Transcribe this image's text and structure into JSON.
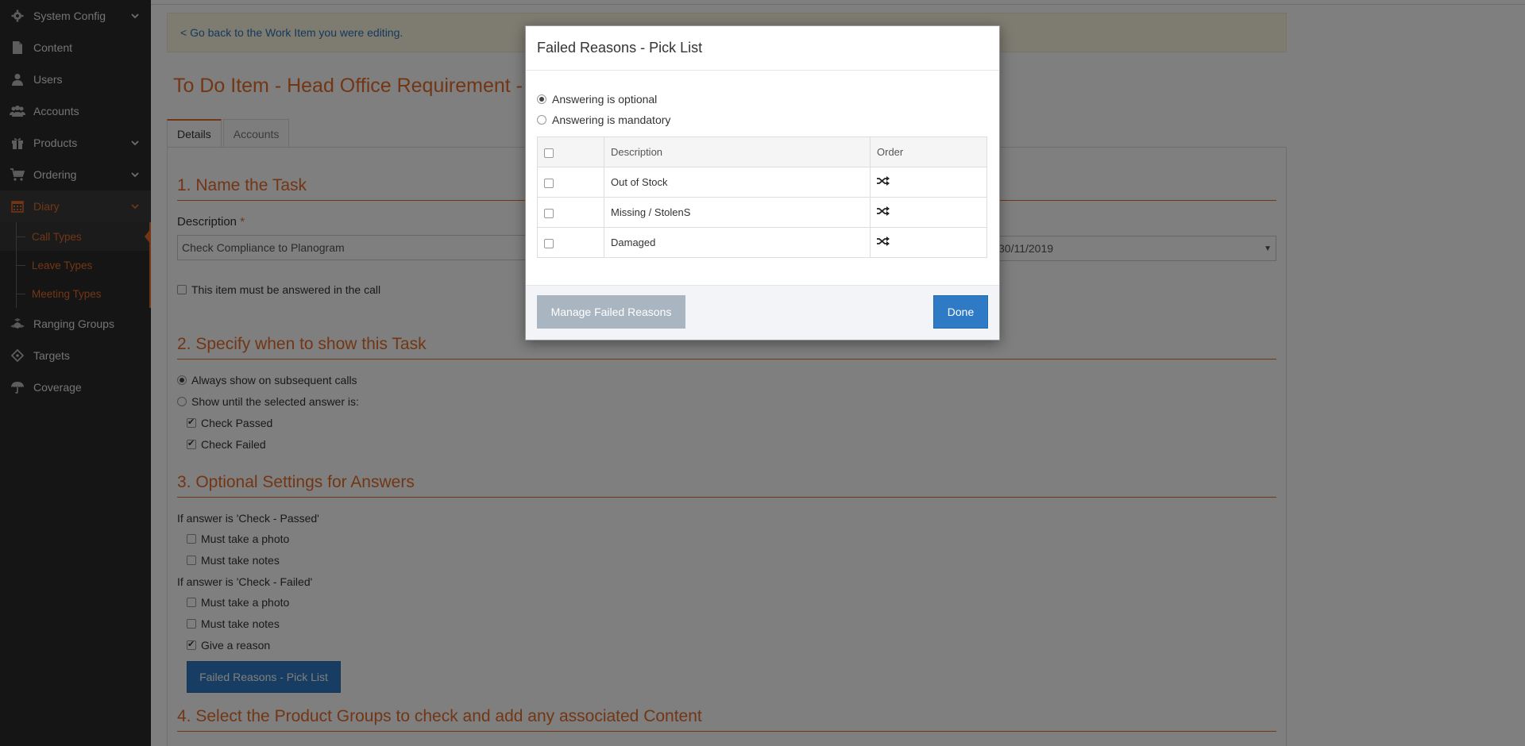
{
  "sidebar": {
    "items": [
      {
        "label": "System Config",
        "icon": "gear-icon",
        "has_chevron": true
      },
      {
        "label": "Content",
        "icon": "file-icon",
        "has_chevron": false
      },
      {
        "label": "Users",
        "icon": "user-icon",
        "has_chevron": false
      },
      {
        "label": "Accounts",
        "icon": "users-icon",
        "has_chevron": false
      },
      {
        "label": "Products",
        "icon": "gift-icon",
        "has_chevron": true
      },
      {
        "label": "Ordering",
        "icon": "cart-icon",
        "has_chevron": true
      },
      {
        "label": "Diary",
        "icon": "calendar-icon",
        "has_chevron": true
      },
      {
        "label": "Ranging Groups",
        "icon": "cubes-icon",
        "has_chevron": false
      },
      {
        "label": "Targets",
        "icon": "crosshairs-icon",
        "has_chevron": false
      },
      {
        "label": "Coverage",
        "icon": "umbrella-icon",
        "has_chevron": false
      }
    ],
    "diary_sub": [
      "Call Types",
      "Leave Types",
      "Meeting Types"
    ]
  },
  "main": {
    "back_link": "< Go back to the Work Item you were editing.",
    "title": "To Do Item - Head Office Requirement - C",
    "tabs": [
      "Details",
      "Accounts"
    ],
    "section1_title": "1. Name the Task",
    "description_label": "Description",
    "required_mark": "*",
    "description_value": "Check Compliance to Planogram",
    "date_value": "30/11/2019",
    "must_answer_label": "This item must be answered in the call",
    "section2_title": "2. Specify when to show this Task",
    "always_show": "Always show on subsequent calls",
    "show_until": "Show until the selected answer is:",
    "check_passed": "Check Passed",
    "check_failed": "Check Failed",
    "section3_title": "3. Optional Settings for Answers",
    "if_passed": "If answer is 'Check - Passed'",
    "if_failed": "If answer is 'Check - Failed'",
    "must_photo": "Must take a photo",
    "must_notes": "Must take notes",
    "give_reason": "Give a reason",
    "pick_list_button": "Failed Reasons - Pick List",
    "section4_title": "4. Select the Product Groups to check and add any associated Content"
  },
  "modal": {
    "title": "Failed Reasons - Pick List",
    "option_optional": "Answering is optional",
    "option_mandatory": "Answering is mandatory",
    "columns": [
      "Description",
      "Order"
    ],
    "rows": [
      "Out of Stock",
      "Missing / StolenS",
      "Damaged"
    ],
    "order_icon": "shuffle-icon",
    "manage_button": "Manage Failed Reasons",
    "done_button": "Done"
  },
  "colors": {
    "accent": "#e46c2a",
    "primary": "#2f7ac4",
    "sidebar": "#2b2b2b"
  }
}
